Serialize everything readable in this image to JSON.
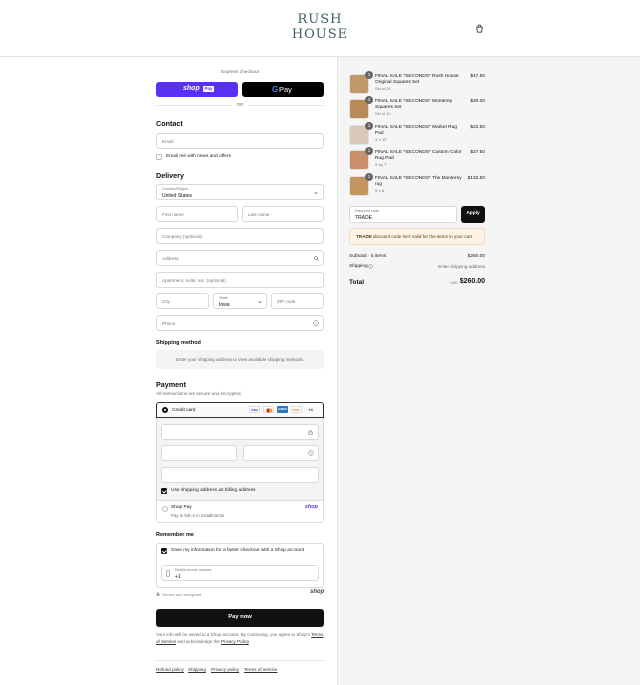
{
  "header": {
    "logo_line1": "RUSH",
    "logo_line2": "HOUSE",
    "cart_icon": "bag-icon"
  },
  "express": {
    "label": "Express checkout",
    "shop_pay_label": "shop",
    "shop_pay_badge": "Pay",
    "gpay_g": "G",
    "gpay_label": "Pay",
    "or_label": "OR"
  },
  "contact": {
    "title": "Contact",
    "email_placeholder": "Email",
    "news_label": "Email me with news and offers",
    "news_checked": false
  },
  "delivery": {
    "title": "Delivery",
    "country_label": "Country/Region",
    "country_value": "United States",
    "first_name": "First name",
    "last_name": "Last name",
    "company": "Company (optional)",
    "address": "Address",
    "apartment": "Apartment, suite, etc. (optional)",
    "city": "City",
    "state_label": "State",
    "state_value": "Iowa",
    "zip": "ZIP code",
    "phone": "Phone"
  },
  "shipping_method": {
    "title": "Shipping method",
    "message": "Enter your shipping address to view available shipping methods."
  },
  "payment": {
    "title": "Payment",
    "subtitle": "All transactions are secure and encrypted.",
    "credit_card_label": "Credit card",
    "card_brands": [
      "VISA",
      "MC",
      "AMEX",
      "DISC",
      "+4"
    ],
    "billing_same_label": "Use shipping address as billing address",
    "billing_same_checked": true,
    "shop_pay_title": "Shop Pay",
    "shop_pay_sub": "Pay in full or in installments",
    "shop_pay_logo": "shop"
  },
  "remember": {
    "title": "Remember me",
    "save_label": "Save my information for a faster checkout with a Shop account",
    "save_checked": true,
    "mobile_label": "Mobile phone number",
    "mobile_value": "+1",
    "secure_label": "Secure and encrypted",
    "shop_logo": "shop"
  },
  "pay_now": "Pay now",
  "disclaimer": {
    "text": "Your info will be saved to a Shop account. By continuing, you agree to Shop's",
    "terms": "Terms of Service",
    "middle": "and acknowledge the",
    "privacy": "Privacy Policy",
    "end": "."
  },
  "footer_links": [
    "Refund policy",
    "Shipping",
    "Privacy policy",
    "Terms of service"
  ],
  "cart": {
    "items": [
      {
        "qty": "1",
        "title": "FINAL SALE *SECONDS* Rush House Original Squares Set",
        "variant": "Set of 24",
        "price": "$47.50",
        "color": "#c0996b"
      },
      {
        "qty": "1",
        "title": "FINAL SALE *SECONDS* Monterey Squares Set",
        "variant": "Set of 12",
        "price": "$30.00",
        "color": "#b88a59"
      },
      {
        "qty": "1",
        "title": "FINAL SALE *SECONDS* Market Rug Pad",
        "variant": "3' x 12'",
        "price": "$22.50",
        "color": "#d9c9b8"
      },
      {
        "qty": "1",
        "title": "FINAL SALE *SECONDS* Custom Color Rug Pad",
        "variant": "5' by 7'",
        "price": "$27.50",
        "color": "#c98f6b"
      },
      {
        "qty": "1",
        "title": "FINAL SALE *SECONDS* The Monterey rug",
        "variant": "5' x 8'",
        "price": "$132.50",
        "color": "#c4965f"
      }
    ],
    "discount_label": "Discount code",
    "discount_value": "TRADE",
    "apply_label": "Apply",
    "discount_error_code": "TRADE",
    "discount_error_text": "discount code isn't valid for the items in your cart",
    "subtotal_label": "Subtotal · 5 items",
    "subtotal_value": "$260.00",
    "shipping_label": "Shipping",
    "shipping_value": "Enter shipping address",
    "total_label": "Total",
    "total_currency": "USD",
    "total_value": "$260.00"
  }
}
